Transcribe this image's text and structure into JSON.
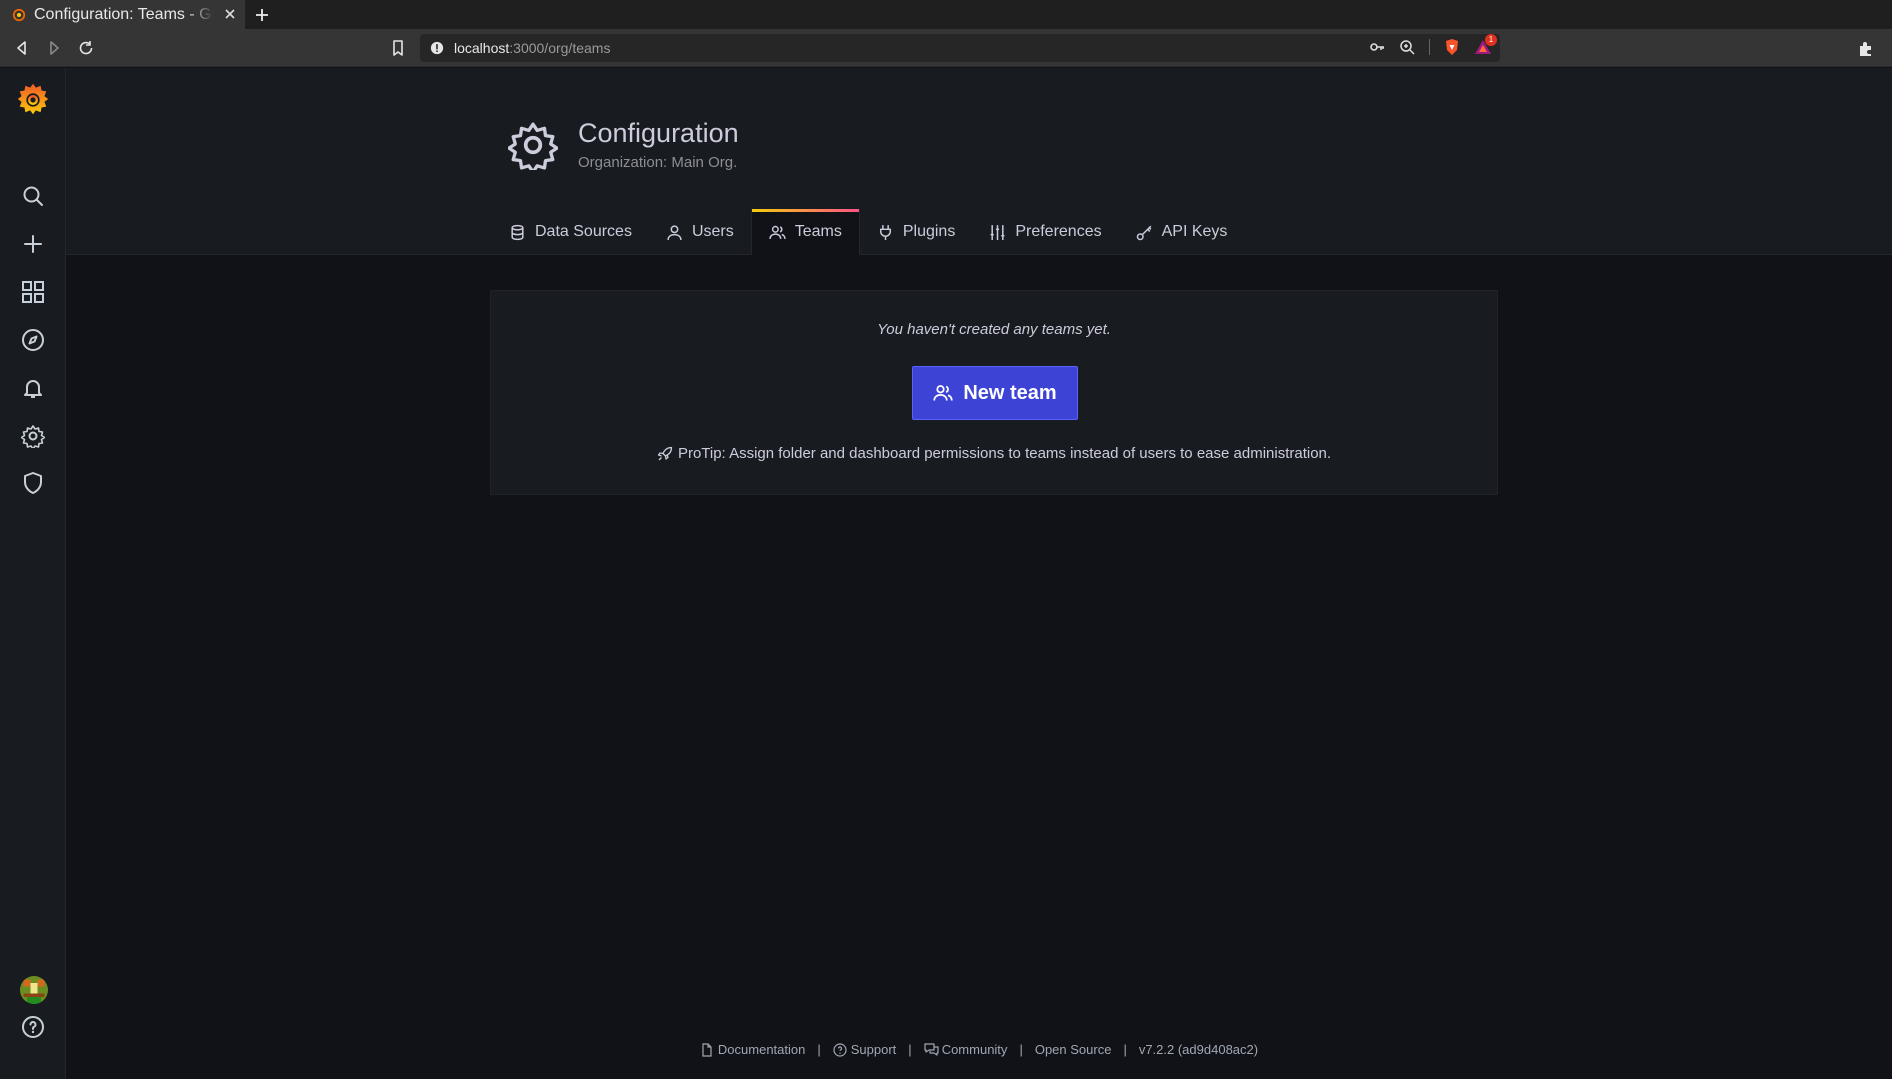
{
  "browser": {
    "tab_title": "Configuration: Teams - Grafana",
    "url_host": "localhost",
    "url_rest": ":3000/org/teams",
    "notification_count": "1"
  },
  "sidebar": {
    "items": [
      {
        "name": "search"
      },
      {
        "name": "create"
      },
      {
        "name": "dashboards"
      },
      {
        "name": "explore"
      },
      {
        "name": "alerting"
      },
      {
        "name": "configuration"
      },
      {
        "name": "server-admin"
      },
      {
        "name": "help"
      }
    ]
  },
  "header": {
    "title": "Configuration",
    "subtitle": "Organization: Main Org."
  },
  "tabs": [
    {
      "label": "Data Sources",
      "icon": "database-icon"
    },
    {
      "label": "Users",
      "icon": "user-icon"
    },
    {
      "label": "Teams",
      "icon": "users-icon",
      "active": true
    },
    {
      "label": "Plugins",
      "icon": "plug-icon"
    },
    {
      "label": "Preferences",
      "icon": "sliders-icon"
    },
    {
      "label": "API Keys",
      "icon": "key-icon"
    }
  ],
  "empty_state": {
    "message": "You haven't created any teams yet.",
    "button_label": "New team",
    "protip": "ProTip: Assign folder and dashboard permissions to teams instead of users to ease administration."
  },
  "footer": {
    "documentation": "Documentation",
    "support": "Support",
    "community": "Community",
    "open_source": "Open Source",
    "version": "v7.2.2 (ad9d408ac2)"
  },
  "colors": {
    "primary_button": "#3d44d5",
    "active_tab_gradient_start": "#f2cc0c",
    "active_tab_gradient_end": "#ff5286",
    "page_bg": "#111217",
    "panel_bg": "#181b1f"
  }
}
